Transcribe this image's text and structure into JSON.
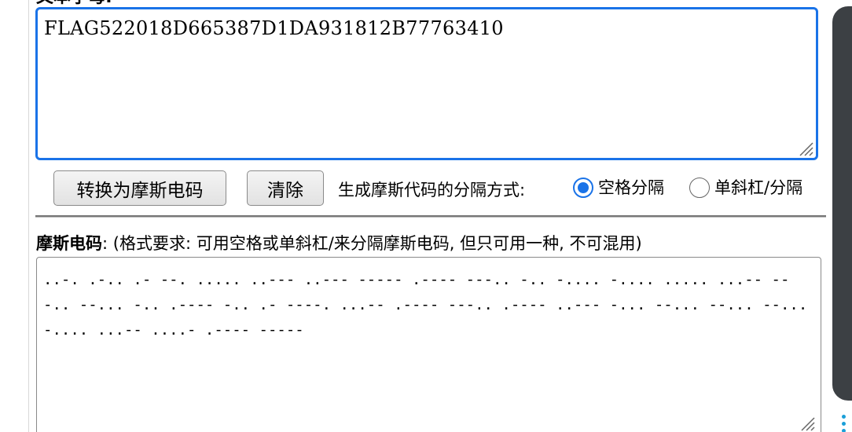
{
  "plaintext": {
    "label": "文本字母:",
    "value": "FLAG522018D665387D1DA931812B77763410"
  },
  "actions": {
    "convert_label": "转换为摩斯电码",
    "clear_label": "清除"
  },
  "separator": {
    "label": "生成摩斯代码的分隔方式:",
    "options": [
      {
        "label": "空格分隔",
        "checked": true
      },
      {
        "label": "单斜杠/分隔",
        "checked": false
      }
    ]
  },
  "morse": {
    "label": "摩斯电码",
    "hint": ":  (格式要求: 可用空格或单斜杠/来分隔摩斯电码, 但只可用一种, 不可混用)",
    "value": "..-. .-.. .- --. ..... ..--- ..--- ----- .---- ---.. -.. -.... -.... ..... ...-- ---.. --... -.. .---- -.. .- ----. ...-- .---- ---.. .---- ..--- -... --... --... --... -.... ...-- ....- .---- -----"
  },
  "icons": {
    "radio_checked": "radio-checked-icon",
    "radio_unchecked": "radio-unchecked-icon",
    "resize": "resize-grip-icon",
    "more": "kebab-menu-icon"
  },
  "colors": {
    "accent": "#1a73e8",
    "panel": "#3c4044",
    "menu_dots": "#1a9fd8"
  }
}
